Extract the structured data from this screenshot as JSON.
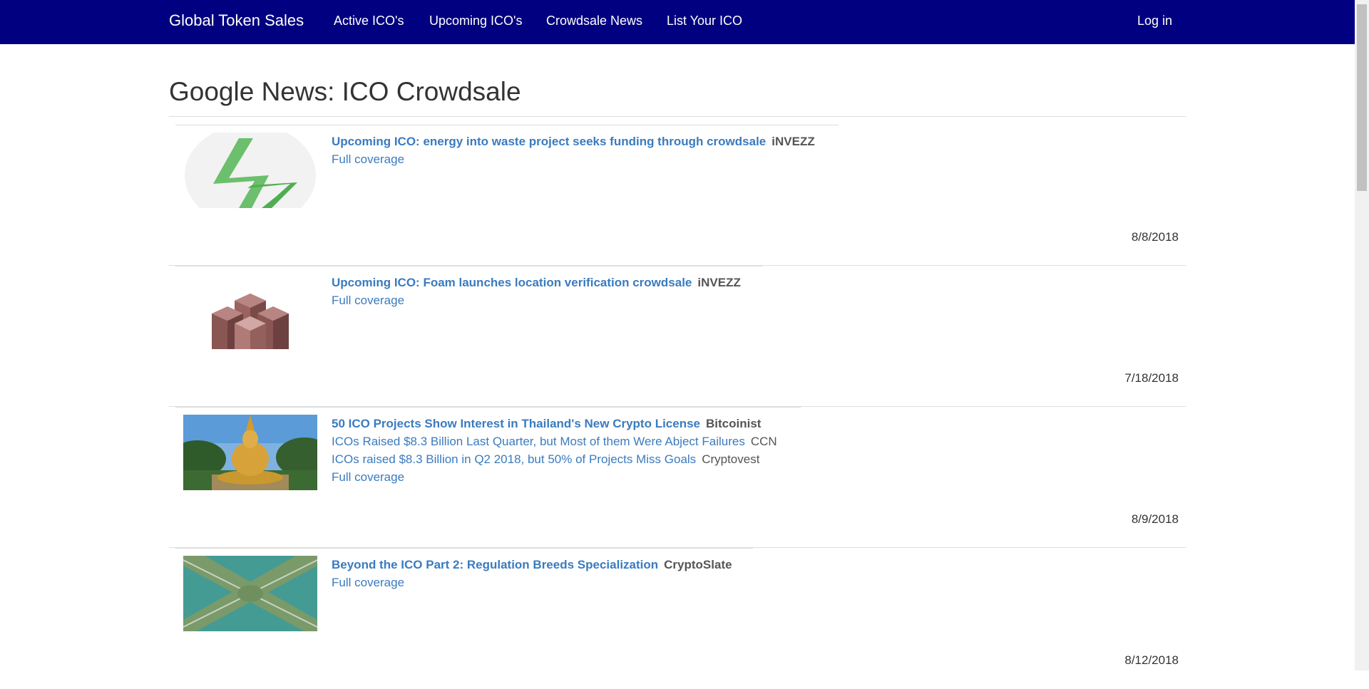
{
  "navbar": {
    "brand": "Global Token Sales",
    "links": [
      "Active ICO's",
      "Upcoming ICO's",
      "Crowdsale News",
      "List Your ICO"
    ],
    "login": "Log in",
    "background": "#000080"
  },
  "page": {
    "title": "Google News: ICO Crowdsale"
  },
  "news": [
    {
      "headline": "Upcoming ICO: energy into waste project seeks funding through crowdsale",
      "source": "iNVEZZ",
      "related": [],
      "coverage": "Full coverage",
      "date": "8/8/2018",
      "thumbnail": "green-lightning-logo"
    },
    {
      "headline": "Upcoming ICO: Foam launches location verification crowdsale",
      "source": "iNVEZZ",
      "related": [],
      "coverage": "Full coverage",
      "date": "7/18/2018",
      "thumbnail": "copper-cubes-logo"
    },
    {
      "headline": "50 ICO Projects Show Interest in Thailand's New Crypto License",
      "source": "Bitcoinist",
      "related": [
        {
          "title": "ICOs Raised $8.3 Billion Last Quarter, but Most of them Were Abject Failures",
          "source": "CCN"
        },
        {
          "title": "ICOs raised $8.3 Billion in Q2 2018, but 50% of Projects Miss Goals",
          "source": "Cryptovest"
        }
      ],
      "coverage": "Full coverage",
      "date": "8/9/2018",
      "thumbnail": "golden-buddha-photo"
    },
    {
      "headline": "Beyond the ICO Part 2: Regulation Breeds Specialization",
      "source": "CryptoSlate",
      "related": [],
      "coverage": "Full coverage",
      "date": "8/12/2018",
      "thumbnail": "highway-interchange-photo"
    }
  ]
}
